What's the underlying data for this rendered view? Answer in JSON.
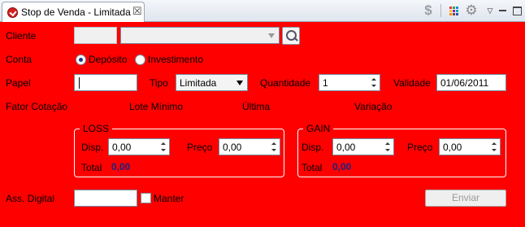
{
  "tab": {
    "title": "Stop de Venda - Limitada",
    "close": "☒"
  },
  "toolbar": {
    "dollar": "$",
    "gear": "⚙",
    "menu": "▽"
  },
  "icons": [
    "app-icon",
    "close-icon",
    "dollar-icon",
    "color-grid-icon",
    "gear-icon",
    "view-menu-icon",
    "minimize-icon",
    "maximize-icon",
    "search-icon",
    "chevron-down-icon"
  ],
  "form": {
    "cliente": {
      "label": "Cliente",
      "code": "",
      "name": ""
    },
    "conta": {
      "label": "Conta",
      "options": [
        "Depósito",
        "Investimento"
      ],
      "selected": "Depósito"
    },
    "papel": {
      "label": "Papel",
      "value": ""
    },
    "tipo": {
      "label": "Tipo",
      "value": "Limitada"
    },
    "quantidade": {
      "label": "Quantidade",
      "value": "1"
    },
    "validade": {
      "label": "Validade",
      "value": "01/06/2011"
    },
    "info": {
      "fator": "Fator Cotação",
      "lote": "Lote Mínimo",
      "ultima": "Última",
      "variacao": "Variação"
    }
  },
  "loss": {
    "title": "LOSS",
    "disp_label": "Disp.",
    "disp_value": "0,00",
    "preco_label": "Preço",
    "preco_value": "0,00",
    "total_label": "Total",
    "total_value": "0,00"
  },
  "gain": {
    "title": "GAIN",
    "disp_label": "Disp.",
    "disp_value": "0,00",
    "preco_label": "Preço",
    "preco_value": "0,00",
    "total_label": "Total",
    "total_value": "0,00"
  },
  "footer": {
    "assinatura_label": "Ass. Digital",
    "assinatura_value": "",
    "manter_label": "Manter",
    "manter_checked": false,
    "enviar_label": "Enviar"
  },
  "colors": {
    "panel": "#ff0000",
    "total_value": "#1a237e",
    "group_border": "#ffffff"
  }
}
